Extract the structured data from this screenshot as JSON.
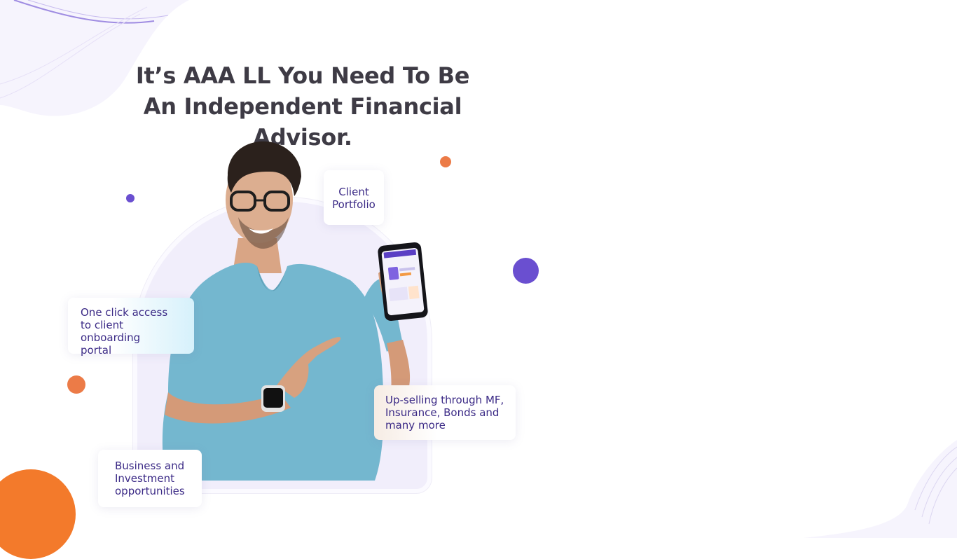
{
  "headline": {
    "line1": "It’s AAA LL You Need To Be",
    "line2": "An Independent Financial Advisor."
  },
  "cards": {
    "portfolio": [
      "Client",
      "Portfolio"
    ],
    "onboarding": [
      "One click access",
      "to client onboarding",
      "portal"
    ],
    "upsell": [
      "Up-selling through MF,",
      "Insurance, Bonds and",
      "many more"
    ],
    "business": [
      "Business and",
      "Investment",
      "opportunities"
    ]
  },
  "colors": {
    "accent_purple": "#6a4fd0",
    "accent_orange": "#f37a2b",
    "heading": "#3e3b45",
    "card_text": "#3b2a86",
    "arch_fill": "#f1eefb"
  },
  "icons": [
    "decorative-wave",
    "decorative-dot",
    "smartwatch",
    "smartphone"
  ]
}
